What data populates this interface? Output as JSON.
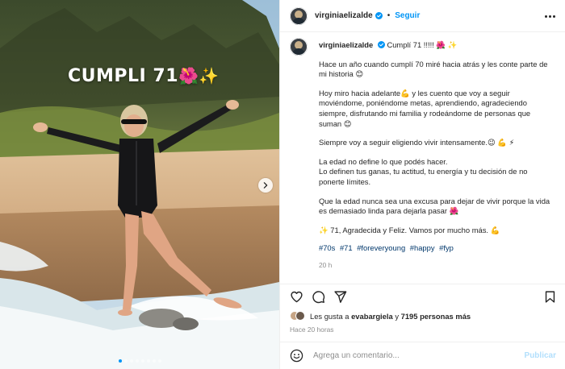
{
  "post": {
    "overlay_text": "CUMPLI 71",
    "overlay_emoji": "🌺✨",
    "media_dots": 8,
    "active_dot": 0
  },
  "header": {
    "username": "virginiaelizalde",
    "follow_label": "Seguir",
    "separator": "•"
  },
  "caption": {
    "username": "virginiaelizalde",
    "first_line": "Cumplí 71 !!!!! 🌺 ✨",
    "paragraphs": [
      "Hace un año cuando cumplí 70 miré hacia atrás y les conte parte de mi historia 😊",
      "Hoy miro hacia adelante💪 y les cuento que voy a seguir moviéndome, poniéndome metas, aprendiendo, agradeciendo siempre, disfrutando mi familia y rodeándome de personas que suman 😊",
      "Siempre voy a seguir eligiendo vivir intensamente.😉 💪 ⚡",
      "La edad no define lo que podés hacer.\nLo definen tus ganas, tu actitud, tu energía y tu decisión de no ponerte límites.",
      "Que la edad nunca sea una excusa para dejar de vivir porque la vida es demasiado linda para dejarla pasar 🌺",
      "✨ 71, Agradecida y Feliz. Vamos por mucho más. 💪"
    ],
    "hashtags": [
      "#70s",
      "#71",
      "#foreveryoung",
      "#happy",
      "#fyp"
    ],
    "time": "20 h"
  },
  "likes": {
    "prefix": "Les gusta a",
    "user": "evabargiela",
    "connector": "y",
    "count_text": "7195 personas más"
  },
  "posted_ago": "Hace 20 horas",
  "comment": {
    "placeholder": "Agrega un comentario...",
    "publish_label": "Publicar"
  },
  "colors": {
    "accent": "#0095f6",
    "hashtag": "#00376b",
    "muted": "#8e8e8e",
    "publish_disabled": "#b2dffc"
  }
}
